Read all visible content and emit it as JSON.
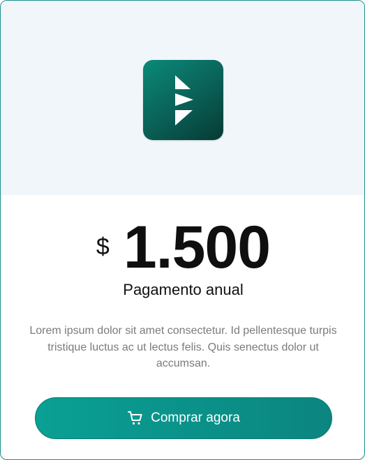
{
  "plan": {
    "currency": "$",
    "amount": "1.500",
    "period": "Pagamento anual",
    "description": "Lorem ipsum dolor sit amet consectetur. Id pellentesque turpis tristique luctus ac ut lectus felis. Quis senectus dolor ut accumsan."
  },
  "button": {
    "label": "Comprar agora",
    "icon": "cart-icon"
  },
  "logo": {
    "icon": "brand-logo"
  },
  "colors": {
    "accent": "#0a9a8f",
    "hero_background": "#f1f6fb",
    "logo_dark": "#053b35"
  }
}
